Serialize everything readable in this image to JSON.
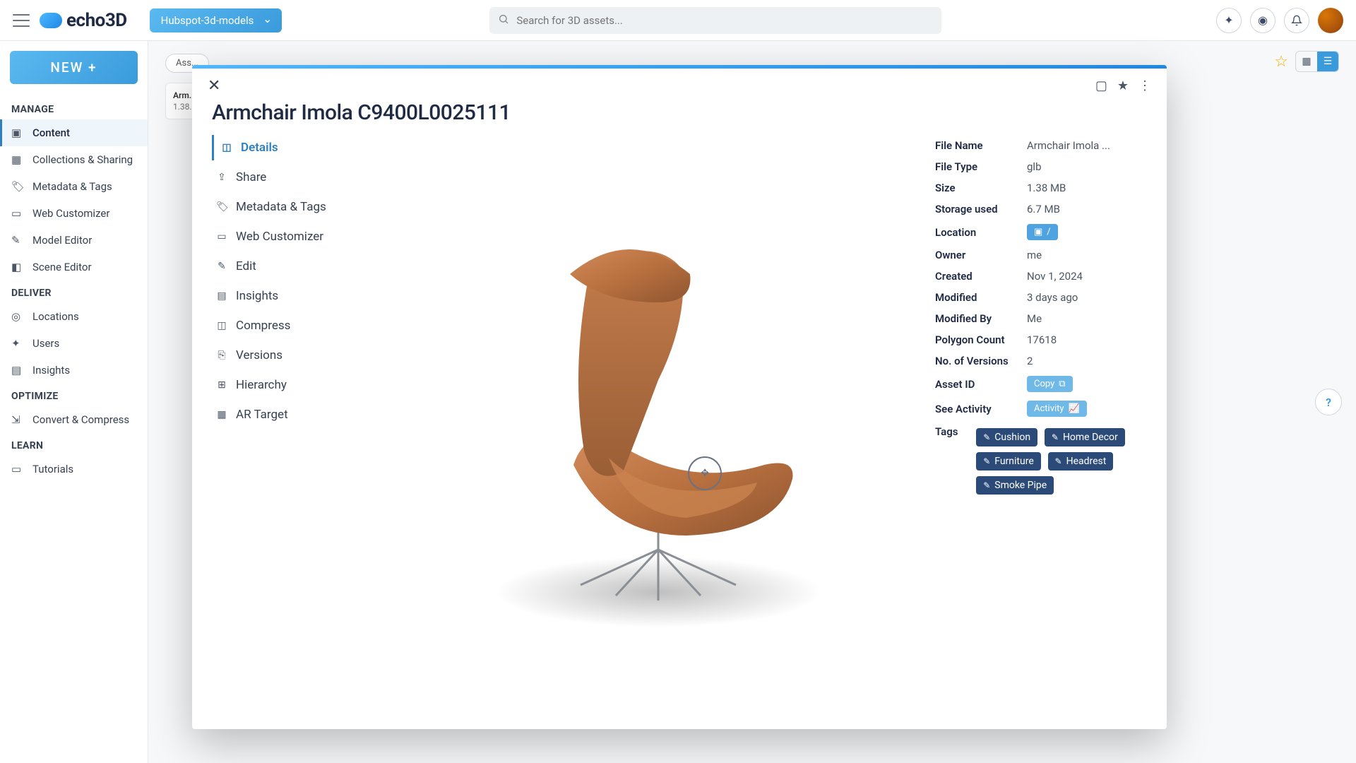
{
  "header": {
    "brand": "echo3D",
    "project": "Hubspot-3d-models",
    "search_placeholder": "Search for 3D assets..."
  },
  "sidebar": {
    "new_label": "NEW +",
    "sections": {
      "manage": "MANAGE",
      "deliver": "DELIVER",
      "optimize": "OPTIMIZE",
      "learn": "LEARN"
    },
    "items": {
      "content": "Content",
      "collections": "Collections & Sharing",
      "metadata": "Metadata & Tags",
      "webcustom": "Web Customizer",
      "modeleditor": "Model Editor",
      "sceneeditor": "Scene Editor",
      "locations": "Locations",
      "users": "Users",
      "insights": "Insights",
      "convert": "Convert & Compress",
      "tutorials": "Tutorials"
    }
  },
  "main": {
    "asset_chip": "Ass...",
    "card_title": "Arm...",
    "card_sub": "1.38..."
  },
  "modal": {
    "title": "Armchair Imola C9400L0025111",
    "nav": {
      "details": "Details",
      "share": "Share",
      "metadata": "Metadata & Tags",
      "webcustom": "Web Customizer",
      "edit": "Edit",
      "insights": "Insights",
      "compress": "Compress",
      "versions": "Versions",
      "hierarchy": "Hierarchy",
      "artarget": "AR Target"
    },
    "meta": {
      "file_name_l": "File Name",
      "file_name_v": "Armchair Imola ...",
      "file_type_l": "File Type",
      "file_type_v": "glb",
      "size_l": "Size",
      "size_v": "1.38 MB",
      "storage_l": "Storage used",
      "storage_v": "6.7 MB",
      "location_l": "Location",
      "location_v": "/",
      "owner_l": "Owner",
      "owner_v": "me",
      "created_l": "Created",
      "created_v": "Nov 1, 2024",
      "modified_l": "Modified",
      "modified_v": "3 days ago",
      "modifiedby_l": "Modified By",
      "modifiedby_v": "Me",
      "poly_l": "Polygon Count",
      "poly_v": "17618",
      "versions_l": "No. of Versions",
      "versions_v": "2",
      "assetid_l": "Asset ID",
      "copy_btn": "Copy",
      "activity_l": "See Activity",
      "activity_btn": "Activity",
      "tags_l": "Tags"
    },
    "tags": [
      "Cushion",
      "Home Decor",
      "Furniture",
      "Headrest",
      "Smoke Pipe"
    ]
  },
  "help": "?"
}
